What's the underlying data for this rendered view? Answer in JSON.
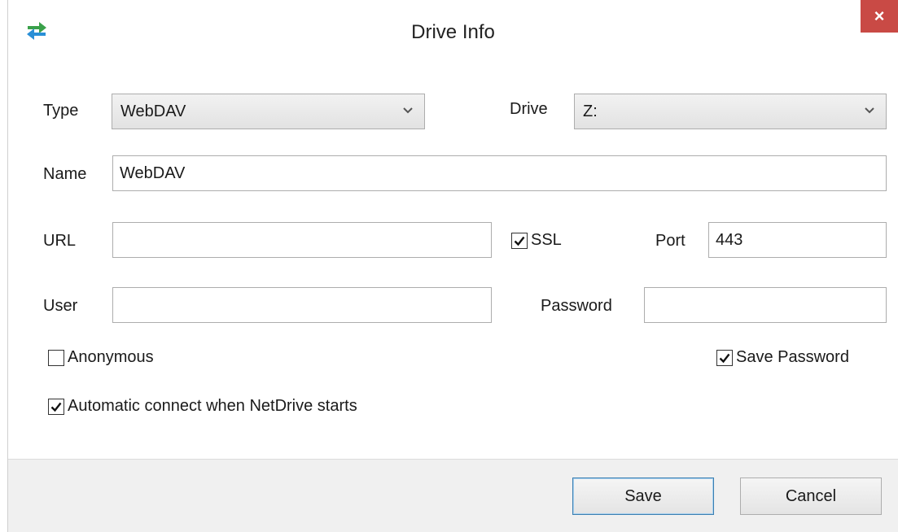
{
  "window": {
    "title": "Drive Info",
    "close_label": "×"
  },
  "form": {
    "type_label": "Type",
    "type_value": "WebDAV",
    "drive_label": "Drive",
    "drive_value": "Z:",
    "name_label": "Name",
    "name_value": "WebDAV",
    "url_label": "URL",
    "url_value": "",
    "ssl_label": "SSL",
    "ssl_checked": true,
    "port_label": "Port",
    "port_value": "443",
    "user_label": "User",
    "user_value": "",
    "password_label": "Password",
    "password_value": "",
    "anonymous_label": "Anonymous",
    "anonymous_checked": false,
    "save_password_label": "Save Password",
    "save_password_checked": true,
    "auto_connect_label": "Automatic connect when NetDrive starts",
    "auto_connect_checked": true
  },
  "footer": {
    "save_label": "Save",
    "cancel_label": "Cancel"
  },
  "colors": {
    "close_button": "#c94a45",
    "icon_green": "#3aa14a",
    "icon_blue": "#2a8fd6"
  }
}
